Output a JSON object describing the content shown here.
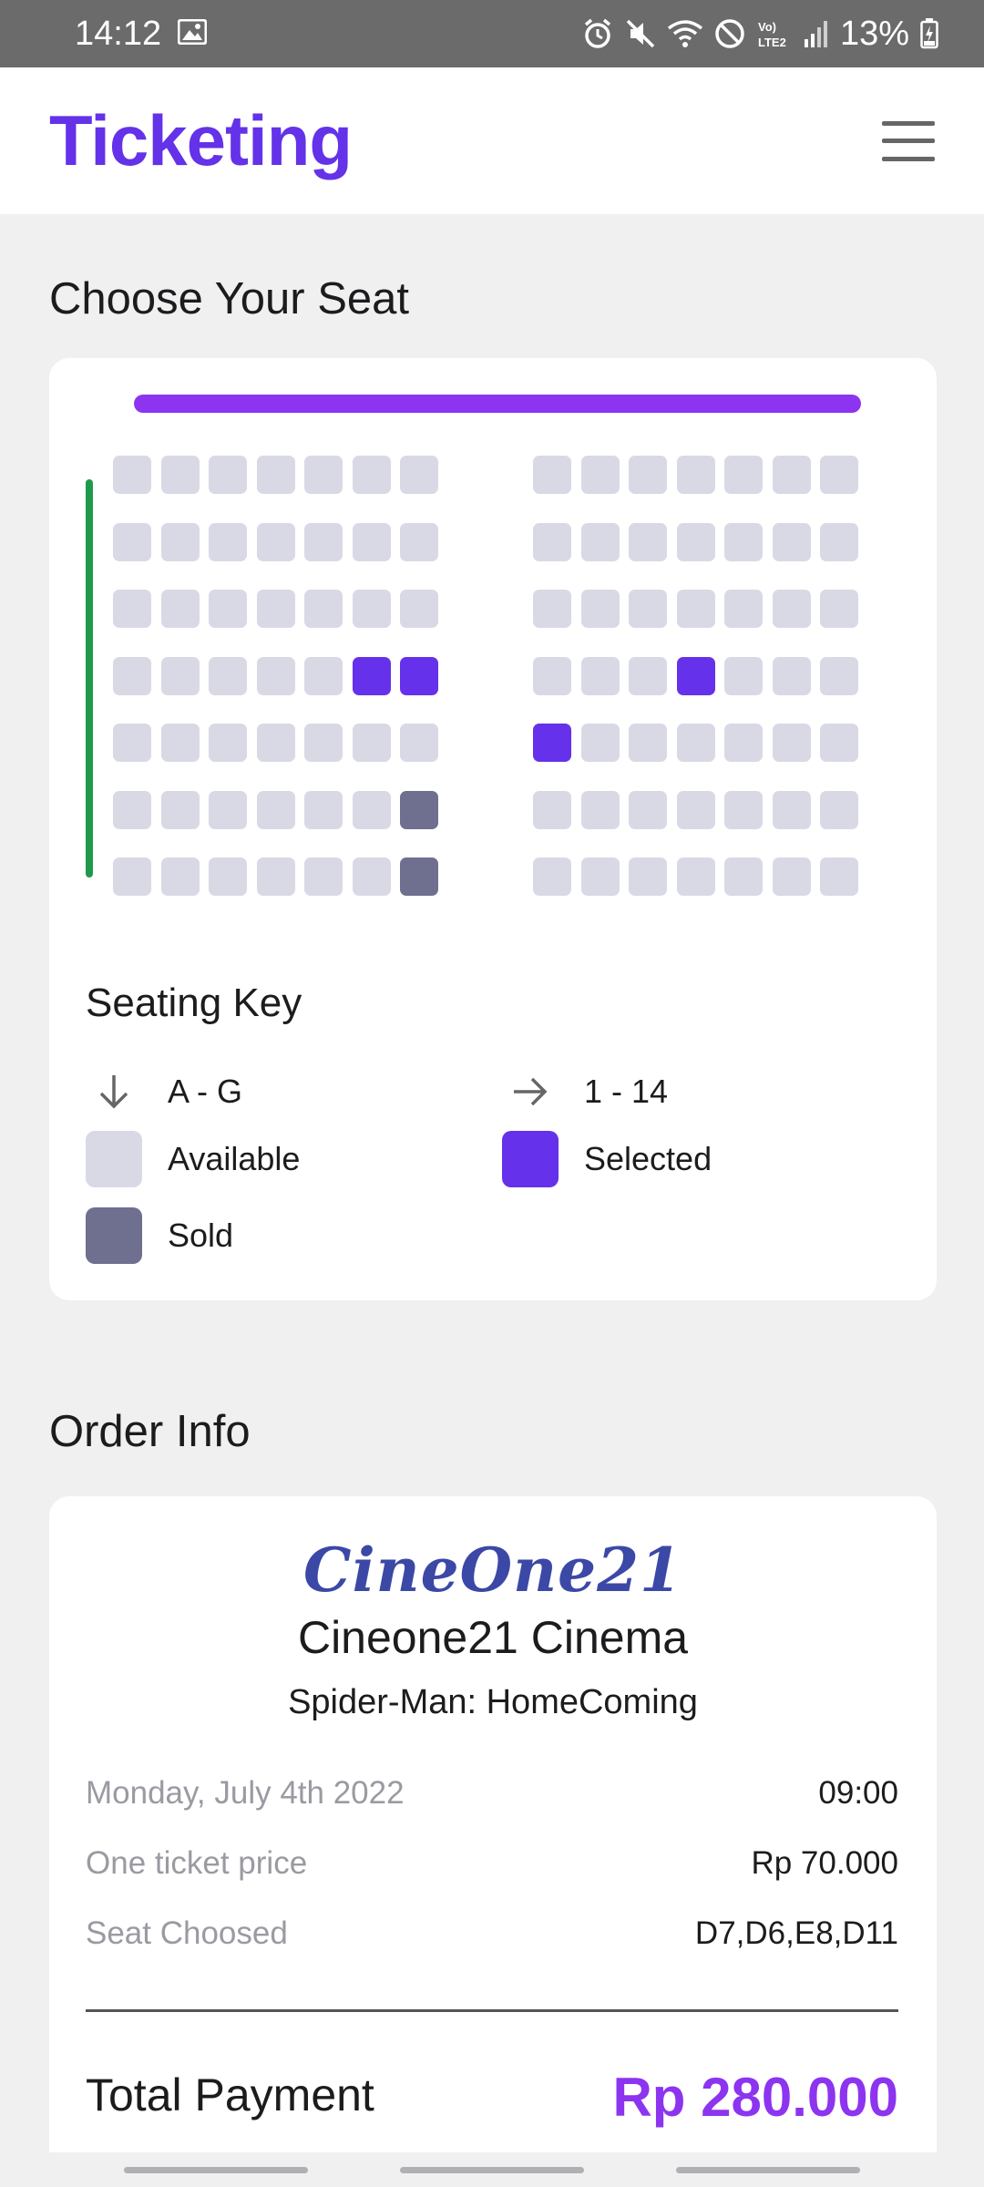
{
  "status_bar": {
    "time": "14:12",
    "battery": "13%",
    "icons": [
      "image-icon",
      "alarm-icon",
      "mute-icon",
      "wifi-icon",
      "do-not-disturb-icon",
      "volte-icon",
      "signal-icon",
      "battery-icon"
    ]
  },
  "header": {
    "title": "Ticketing",
    "menu_icon": "hamburger-menu-icon"
  },
  "seat_section": {
    "title": "Choose Your Seat",
    "screen_color": "#8c34f0",
    "aisle_color": "#1f9a4b",
    "rows": [
      "A",
      "B",
      "C",
      "D",
      "E",
      "F",
      "G"
    ],
    "left_block": [
      [
        "available",
        "available",
        "available",
        "available",
        "available",
        "available",
        "available"
      ],
      [
        "available",
        "available",
        "available",
        "available",
        "available",
        "available",
        "available"
      ],
      [
        "available",
        "available",
        "available",
        "available",
        "available",
        "available",
        "available"
      ],
      [
        "available",
        "available",
        "available",
        "available",
        "available",
        "selected",
        "selected"
      ],
      [
        "available",
        "available",
        "available",
        "available",
        "available",
        "available",
        "available"
      ],
      [
        "available",
        "available",
        "available",
        "available",
        "available",
        "available",
        "sold"
      ],
      [
        "available",
        "available",
        "available",
        "available",
        "available",
        "available",
        "sold"
      ]
    ],
    "right_block": [
      [
        "available",
        "available",
        "available",
        "available",
        "available",
        "available",
        "available"
      ],
      [
        "available",
        "available",
        "available",
        "available",
        "available",
        "available",
        "available"
      ],
      [
        "available",
        "available",
        "available",
        "available",
        "available",
        "available",
        "available"
      ],
      [
        "available",
        "available",
        "available",
        "selected",
        "available",
        "available",
        "available"
      ],
      [
        "selected",
        "available",
        "available",
        "available",
        "available",
        "available",
        "available"
      ],
      [
        "available",
        "available",
        "available",
        "available",
        "available",
        "available",
        "available"
      ],
      [
        "available",
        "available",
        "available",
        "available",
        "available",
        "available",
        "available"
      ]
    ],
    "key": {
      "title": "Seating Key",
      "rows_label": "A - G",
      "cols_label": "1 - 14",
      "available": "Available",
      "selected": "Selected",
      "sold": "Sold"
    },
    "colors": {
      "available": "#d9d9e6",
      "selected": "#6531ea",
      "sold": "#6f6f90"
    }
  },
  "order": {
    "title": "Order Info",
    "brand": "CineOne21",
    "cinema": "Cineone21 Cinema",
    "movie": "Spider-Man: HomeComing",
    "date_label": "Monday, July 4th 2022",
    "time_value": "09:00",
    "price_label": "One ticket price",
    "price_value": "Rp 70.000",
    "seat_label": "Seat Choosed",
    "seat_value": "D7,D6,E8,D11",
    "total_label": "Total Payment",
    "total_value": "Rp 280.000"
  }
}
